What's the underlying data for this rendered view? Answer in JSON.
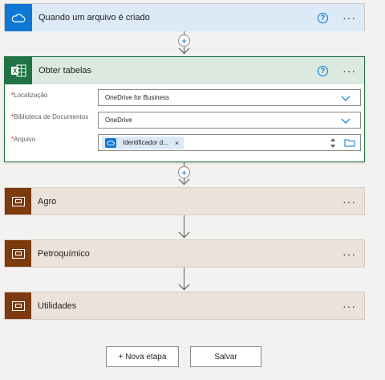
{
  "trigger": {
    "title": "Quando um arquivo é criado",
    "help": "?",
    "more": "···"
  },
  "excel_action": {
    "title": "Obter tabelas",
    "help": "?",
    "more": "···",
    "fields": {
      "location": {
        "label": "Localização",
        "required": "*",
        "value": "OneDrive for Business"
      },
      "library": {
        "label": "Biblioteca de Documentos",
        "required": "*",
        "value": "OneDrive"
      },
      "file": {
        "label": "Arquivo",
        "required": "*",
        "token": "Identificador d...",
        "token_remove": "×"
      }
    }
  },
  "scopes": [
    {
      "title": "Agro",
      "more": "···"
    },
    {
      "title": "Petroquímico",
      "more": "···"
    },
    {
      "title": "Utilidades",
      "more": "···"
    }
  ],
  "connectors": {
    "insert": "+"
  },
  "footer": {
    "new_step_label": "+ Nova etapa",
    "save_label": "Salvar"
  },
  "colors": {
    "onedrive": "#0f78d4",
    "excel": "#217346",
    "scope": "#7e3a0f",
    "trigger_bg": "#dce9f7",
    "excel_bg": "#dbe9e1",
    "scope_bg": "#ede2da"
  }
}
